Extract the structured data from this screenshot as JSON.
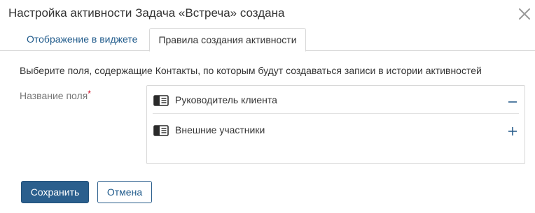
{
  "dialog": {
    "title": "Настройка активности Задача «Встреча» создана"
  },
  "tabs": [
    {
      "label": "Отображение в виджете",
      "active": false
    },
    {
      "label": "Правила создания активности",
      "active": true
    }
  ],
  "instruction": "Выберите поля, содержащие Контакты, по которым будут создаваться записи в истории активностей",
  "field": {
    "label": "Название поля",
    "required_mark": "*",
    "rows": [
      {
        "label": "Руководитель клиента",
        "icon": "field-card-icon",
        "action": "remove"
      },
      {
        "label": "Внешние участники",
        "icon": "field-card-icon",
        "action": "add"
      }
    ]
  },
  "buttons": {
    "save": "Сохранить",
    "cancel": "Отмена"
  },
  "colors": {
    "primary": "#2b5f8d",
    "link": "#1f5a8b",
    "required": "#d0021b"
  }
}
